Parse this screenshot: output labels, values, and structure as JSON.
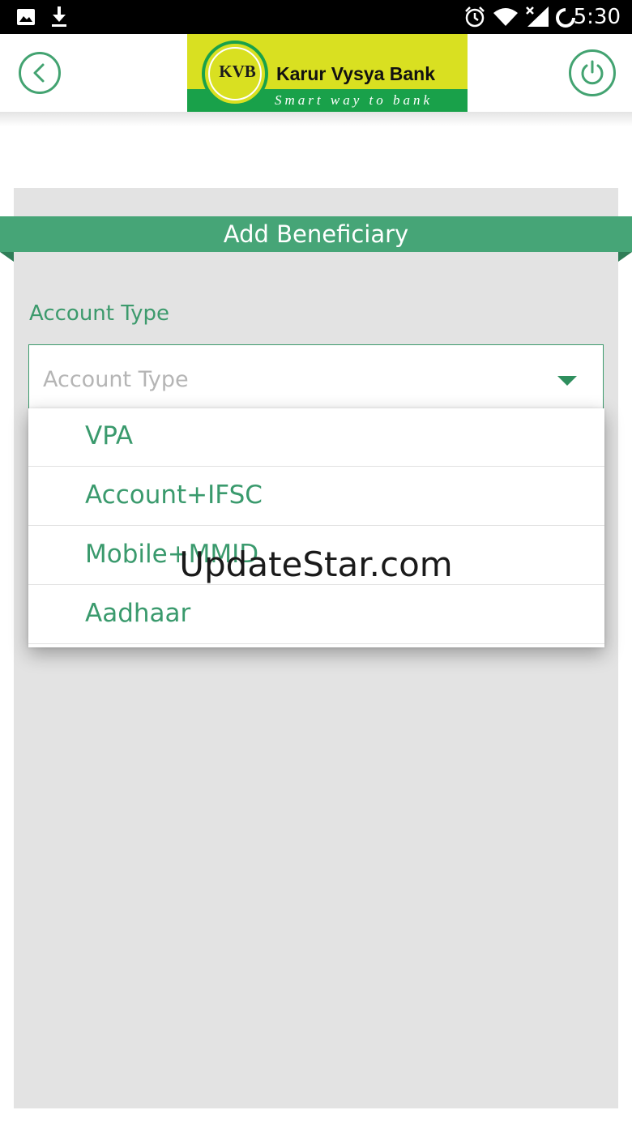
{
  "status_bar": {
    "time": "5:30",
    "icons": [
      "image-icon",
      "download-icon",
      "alarm-icon",
      "wifi-icon",
      "signal-icon",
      "sync-icon"
    ]
  },
  "header": {
    "logo": {
      "mark": "KVB",
      "name": "Karur Vysya Bank",
      "tagline": "Smart way to bank"
    },
    "back_icon": "chevron-left-icon",
    "power_icon": "power-icon"
  },
  "page": {
    "title": "Add Beneficiary"
  },
  "form": {
    "account_type": {
      "label": "Account Type",
      "placeholder": "Account Type",
      "options": [
        "VPA",
        "Account+IFSC",
        "Mobile+MMID",
        "Aadhaar"
      ]
    }
  },
  "watermark": "UpdateStar.com",
  "colors": {
    "accent": "#46a577",
    "text_green": "#3a9a6d",
    "logo_yellow": "#d9e021",
    "logo_green": "#19a14a",
    "card_bg": "#e3e3e3"
  }
}
